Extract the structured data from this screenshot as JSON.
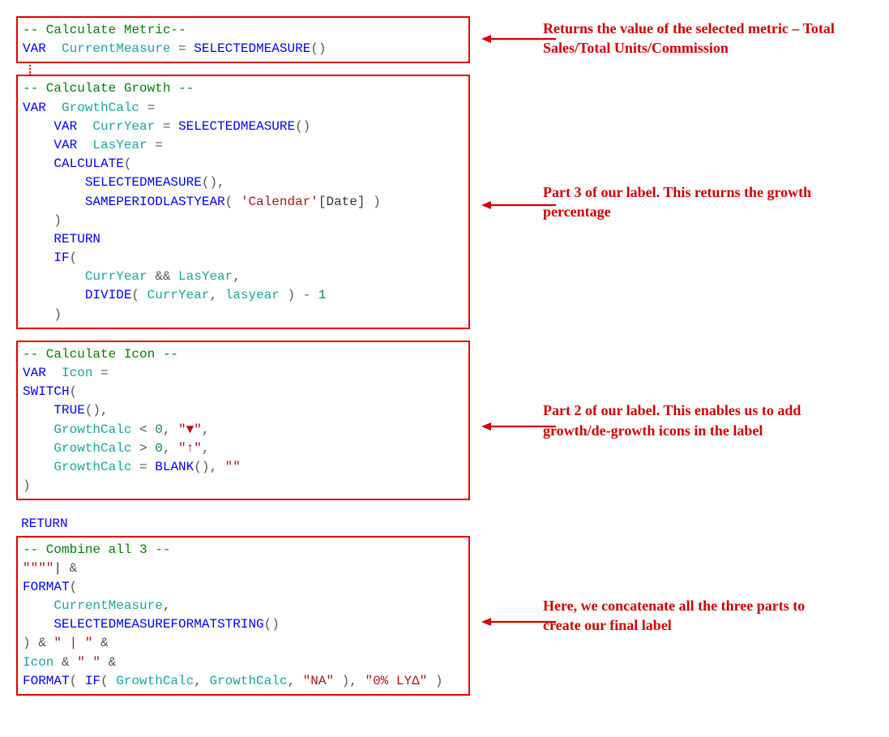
{
  "blocks": {
    "b1": {
      "l1_comment": "-- Calculate Metric--",
      "l2_var": "VAR",
      "l2_name": "  CurrentMeasure",
      "l2_eq": " = ",
      "l2_fn": "SELECTEDMEASURE",
      "l2_paren": "()"
    },
    "b2": {
      "l1_comment": "-- Calculate Growth --",
      "l2": {
        "var": "VAR",
        "name": "  GrowthCalc",
        "eq": " ="
      },
      "l3": {
        "var": "    VAR",
        "name": "  CurrYear",
        "eq": " = ",
        "fn": "SELECTEDMEASURE",
        "paren": "()"
      },
      "l4": {
        "var": "    VAR",
        "name": "  LasYear",
        "eq": " ="
      },
      "l5": {
        "fn": "    CALCULATE",
        "paren": "("
      },
      "l6": {
        "fn": "        SELECTEDMEASURE",
        "paren": "()",
        "comma": ","
      },
      "l7": {
        "fn": "        SAMEPERIODLASTYEAR",
        "paren1": "( ",
        "str": "'Calendar'",
        "brk": "[Date]",
        "paren2": " )"
      },
      "l8": {
        "paren": "    )"
      },
      "l9": {
        "kw": "    RETURN"
      },
      "l10": {
        "kw": "    IF",
        "paren": "("
      },
      "l11": {
        "v1": "        CurrYear",
        "op": " && ",
        "v2": "LasYear",
        "comma": ","
      },
      "l12": {
        "fn": "        DIVIDE",
        "paren1": "( ",
        "v1": "CurrYear",
        "comma": ", ",
        "v2": "lasyear",
        "paren2": " )",
        "op": " - ",
        "num": "1"
      },
      "l13": {
        "paren": "    )"
      }
    },
    "b3": {
      "l1_comment": "-- Calculate Icon --",
      "l2": {
        "var": "VAR",
        "name": "  Icon",
        "eq": " ="
      },
      "l3": {
        "fn": "SWITCH",
        "paren": "("
      },
      "l4": {
        "fn": "    TRUE",
        "paren": "()",
        "comma": ","
      },
      "l5": {
        "v": "    GrowthCalc",
        "op": " < ",
        "num": "0",
        "comma": ", ",
        "q1": "\"",
        "sym": "▼",
        "q2": "\"",
        "comma2": ","
      },
      "l6": {
        "v": "    GrowthCalc",
        "op": " > ",
        "num": "0",
        "comma": ", ",
        "str": "\"↑\"",
        "comma2": ","
      },
      "l7": {
        "v": "    GrowthCalc",
        "op": " = ",
        "fn": "BLANK",
        "paren": "()",
        "comma": ", ",
        "str": "\"\""
      },
      "l8": {
        "paren": ")"
      }
    },
    "ret": {
      "kw": "RETURN"
    },
    "b4": {
      "l1_comment": "-- Combine all 3 --",
      "l2": {
        "str": "\"\"\"\"",
        "cursor": "|",
        "amp": " &"
      },
      "l3": {
        "fn": "FORMAT",
        "paren": "("
      },
      "l4": {
        "v": "    CurrentMeasure",
        "comma": ","
      },
      "l5": {
        "fn": "    SELECTEDMEASUREFORMATSTRING",
        "paren": "()"
      },
      "l6": {
        "paren": ")",
        "amp": " & ",
        "str": "\" | \"",
        "amp2": " &"
      },
      "l7": {
        "v": "Icon",
        "amp": " & ",
        "str": "\" \"",
        "amp2": " &"
      },
      "l8": {
        "fn": "FORMAT",
        "paren1": "( ",
        "kw": "IF",
        "paren2": "( ",
        "v1": "GrowthCalc",
        "c1": ", ",
        "v2": "GrowthCalc",
        "c2": ", ",
        "str1": "\"NA\"",
        "paren3": " )",
        "c3": ", ",
        "str2": "\"0% LYΔ\"",
        "paren4": " )"
      }
    }
  },
  "annotations": {
    "a1": "Returns the value of the selected metric – Total Sales/Total Units/Commission",
    "a2": "Part 3 of our label. This returns the growth percentage",
    "a3": "Part 2 of our label. This enables us to add growth/de-growth icons in the label",
    "a4": "Here, we concatenate all the three parts to create our final label"
  },
  "colors": {
    "border": "#e60000",
    "annotation": "#d00000"
  }
}
